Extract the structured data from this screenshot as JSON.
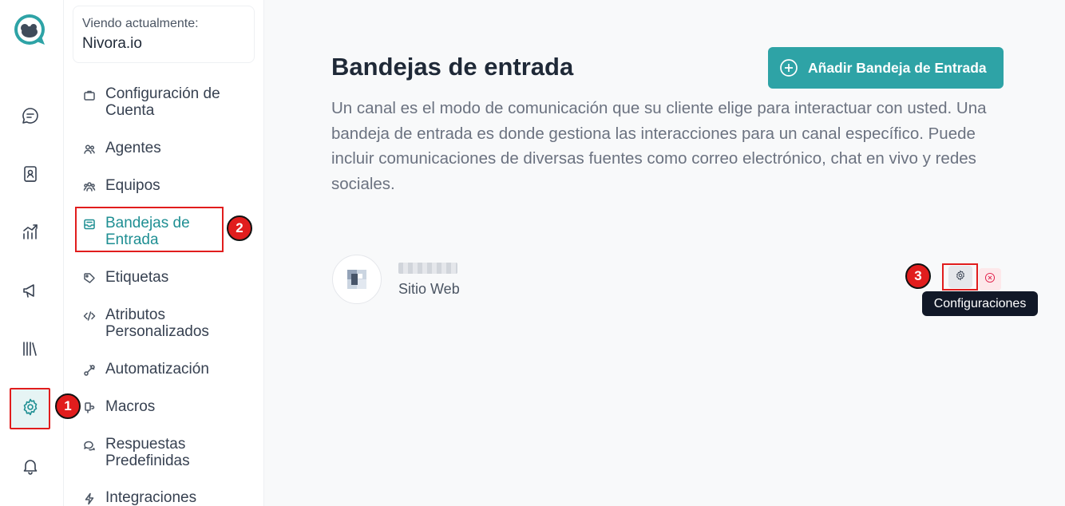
{
  "rail": {
    "items": [
      {
        "name": "conversations",
        "icon": "chat-icon"
      },
      {
        "name": "contacts",
        "icon": "contact-book-icon"
      },
      {
        "name": "reports",
        "icon": "chart-icon"
      },
      {
        "name": "campaigns",
        "icon": "megaphone-icon"
      },
      {
        "name": "library",
        "icon": "library-icon"
      },
      {
        "name": "settings",
        "icon": "gear-icon",
        "active": true
      },
      {
        "name": "notifications",
        "icon": "bell-icon"
      }
    ]
  },
  "account": {
    "label": "Viendo actualmente:",
    "name": "Nivora.io"
  },
  "sidebar": {
    "items": [
      {
        "label": "Configuración de Cuenta",
        "icon": "briefcase-icon"
      },
      {
        "label": "Agentes",
        "icon": "users-icon"
      },
      {
        "label": "Equipos",
        "icon": "team-icon"
      },
      {
        "label": "Bandejas de Entrada",
        "icon": "inbox-icon",
        "active": true
      },
      {
        "label": "Etiquetas",
        "icon": "tag-icon"
      },
      {
        "label": "Atributos Personalizados",
        "icon": "code-icon"
      },
      {
        "label": "Automatización",
        "icon": "automation-icon"
      },
      {
        "label": "Macros",
        "icon": "macro-icon"
      },
      {
        "label": "Respuestas Predefinidas",
        "icon": "chat-bubbles-icon"
      },
      {
        "label": "Integraciones",
        "icon": "lightning-icon"
      }
    ]
  },
  "main": {
    "title": "Bandejas de entrada",
    "description": "Un canal es el modo de comunicación que su cliente elige para interactuar con usted. Una bandeja de entrada es donde gestiona las interacciones para un canal específico. Puede incluir comunicaciones de diversas fuentes como correo electrónico, chat en vivo y redes sociales.",
    "add_button": "Añadir Bandeja de Entrada",
    "inbox": {
      "type": "Sitio Web"
    },
    "tooltip": "Configuraciones"
  },
  "badges": [
    "1",
    "2",
    "3"
  ],
  "colors": {
    "accent": "#2ea3a6",
    "highlight": "#e11d1d",
    "tooltip_bg": "#111827"
  }
}
